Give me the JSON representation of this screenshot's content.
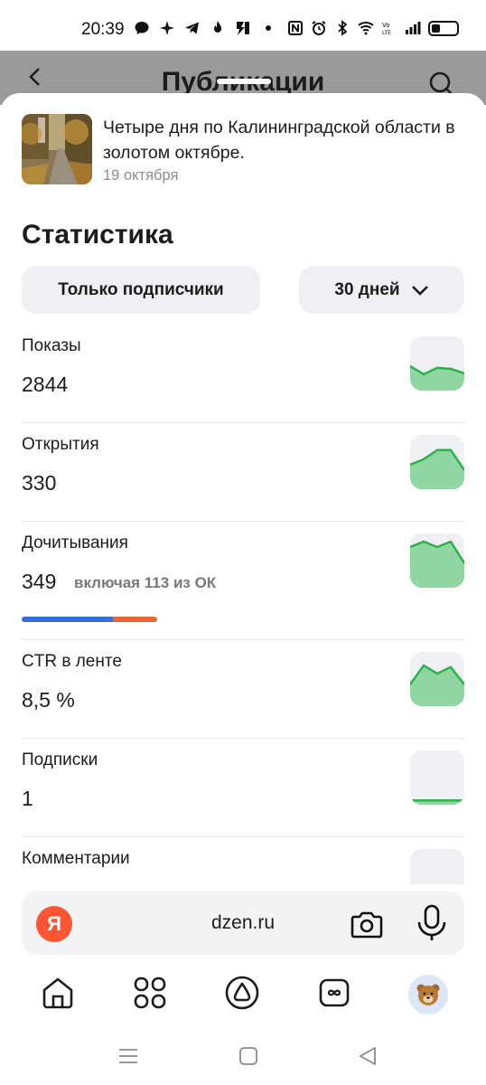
{
  "status_bar": {
    "time": "20:39",
    "icons_left": [
      "chat-icon",
      "sparkle-icon",
      "telegram-icon",
      "flame-icon",
      "app-icon",
      "dot-icon"
    ],
    "icons_right": [
      "nfc-icon",
      "alarm-icon",
      "bluetooth-icon",
      "wifi-icon",
      "volte-icon",
      "signal-icon",
      "battery-icon"
    ]
  },
  "background_header": {
    "title": "Публикации"
  },
  "publication": {
    "title": "Четыре дня по Калининградской области в золотом октябре.",
    "date": "19 октября"
  },
  "stats": {
    "heading": "Статистика",
    "filter_audience": "Только подписчики",
    "filter_period": "30 дней",
    "metrics": [
      {
        "label": "Показы",
        "value": "2844",
        "trend": [
          0.45,
          0.3,
          0.42,
          0.4,
          0.32
        ]
      },
      {
        "label": "Открытия",
        "value": "330",
        "trend": [
          0.45,
          0.55,
          0.72,
          0.72,
          0.35
        ]
      },
      {
        "label": "Дочитывания",
        "value": "349",
        "sub": "включая 113 из ОК",
        "trend": [
          0.75,
          0.85,
          0.75,
          0.85,
          0.45
        ],
        "read_split": {
          "main": 0.676,
          "ok": 0.324
        }
      },
      {
        "label": "CTR в ленте",
        "value": "8,5 %",
        "trend": [
          0.4,
          0.75,
          0.6,
          0.72,
          0.4
        ]
      },
      {
        "label": "Подписки",
        "value": "1",
        "trend": [
          0.08,
          0.08,
          0.08,
          0.08,
          0.08
        ]
      },
      {
        "label": "Комментарии",
        "value": "",
        "trend": []
      }
    ]
  },
  "browser": {
    "logo": "Я",
    "url": "dzen.ru"
  },
  "bottom_nav": [
    "home-icon",
    "apps-grid-icon",
    "alice-icon",
    "loop-icon",
    "avatar"
  ],
  "colors": {
    "accent_green": "#2bb34a",
    "spark_fill": "#8fd6a2",
    "read_blue": "#2f6fe0",
    "read_orange": "#f0622e",
    "chip_bg": "#eef0f3"
  }
}
